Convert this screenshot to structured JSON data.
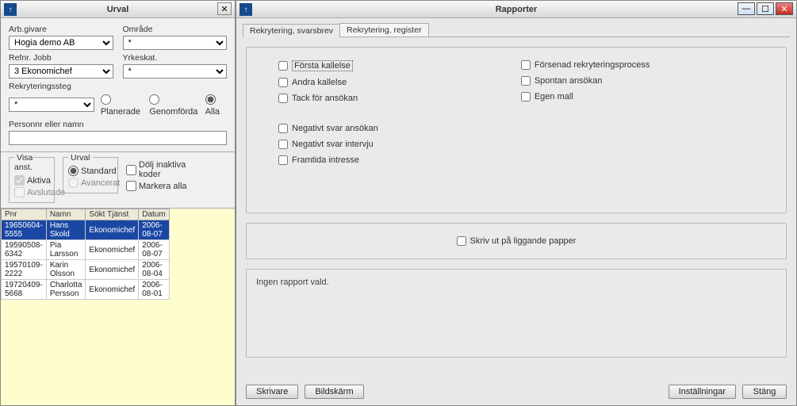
{
  "left": {
    "title": "Urval",
    "labels": {
      "arbgivare": "Arb.givare",
      "omrade": "Område",
      "refnr": "Refnr. Jobb",
      "yrkeskat": "Yrkeskat.",
      "rekryt": "Rekryteringssteg",
      "personnr": "Personnr eller namn",
      "visa": "Visa anst.",
      "aktiva": "Aktiva",
      "avslutade": "Avslutade",
      "urval": "Urval",
      "standard": "Standard",
      "avancerat": "Avancerat",
      "dolj": "Dölj inaktiva koder",
      "markera": "Markera alla",
      "planerade": "Planerade",
      "genomforda": "Genomförda",
      "alla": "Alla"
    },
    "values": {
      "arbgivare": "Hogia demo AB",
      "omrade": "*",
      "refnr": "3   Ekonomichef",
      "yrkeskat": "*",
      "rekryt": "*"
    },
    "table": {
      "headers": [
        "Pnr",
        "Namn",
        "Sökt Tjänst",
        "Datum"
      ],
      "rows": [
        {
          "pnr": "19650604-5555",
          "namn": "Hans Skold",
          "tj": "Ekonomichef",
          "dat": "2006-08-07"
        },
        {
          "pnr": "19590508-6342",
          "namn": "Pia Larsson",
          "tj": "Ekonomichef",
          "dat": "2006-08-07"
        },
        {
          "pnr": "19570109-2222",
          "namn": "Karin Olsson",
          "tj": "Ekonomichef",
          "dat": "2006-08-04"
        },
        {
          "pnr": "19720409-5668",
          "namn": "Charlotta Persson",
          "tj": "Ekonomichef",
          "dat": "2006-08-01"
        }
      ],
      "selected": 0
    }
  },
  "right": {
    "title": "Rapporter",
    "tabs": [
      "Rekrytering, svarsbrev",
      "Rekrytering, register"
    ],
    "activeTab": 0,
    "checks": {
      "colA": [
        "Första kallelse",
        "Andra kallelse",
        "Tack för ansökan",
        "Negativt svar ansökan",
        "Negativt svar intervju",
        "Framtida intresse"
      ],
      "colB": [
        "Försenad rekryteringsprocess",
        "Spontan ansökan",
        "Egen mall"
      ],
      "liggande": "Skriv ut på liggande papper"
    },
    "status": "Ingen rapport vald.",
    "buttons": {
      "skrivare": "Skrivare",
      "bildskarm": "Bildskärm",
      "installningar": "Inställningar",
      "stang": "Stäng"
    }
  }
}
